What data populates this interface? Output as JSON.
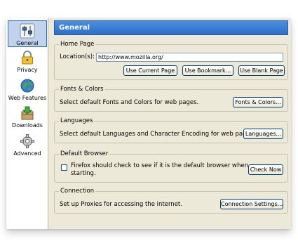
{
  "sidebar": {
    "items": [
      {
        "label": "General",
        "icon": "sliders-icon",
        "selected": true
      },
      {
        "label": "Privacy",
        "icon": "lock-icon"
      },
      {
        "label": "Web Features",
        "icon": "globe-icon"
      },
      {
        "label": "Downloads",
        "icon": "downloads-box-icon"
      },
      {
        "label": "Advanced",
        "icon": "gear-icon"
      }
    ]
  },
  "header": {
    "title": "General"
  },
  "home_page": {
    "title": "Home Page",
    "location_label": "Location(s):",
    "location_value": "http://www.mozilla.org/",
    "use_current": "Use Current Page",
    "use_bookmark": "Use Bookmark...",
    "use_blank": "Use Blank Page"
  },
  "fonts_colors": {
    "title": "Fonts & Colors",
    "description": "Select default Fonts and Colors for web pages.",
    "button": "Fonts & Colors..."
  },
  "languages": {
    "title": "Languages",
    "description": "Select default Languages and Character Encoding for web pages.",
    "button": "Languages..."
  },
  "default_browser": {
    "title": "Default Browser",
    "checkbox_label_line1": "Firefox should check to see if it is the default browser when",
    "checkbox_label_line2": "starting.",
    "checked": false,
    "button": "Check Now"
  },
  "connection": {
    "title": "Connection",
    "description": "Set up Proxies for accessing the internet.",
    "button": "Connection Settings..."
  },
  "colors": {
    "header_blue": "#2f6fc7",
    "panel_bg": "#ece9d8",
    "selected_bg": "#c1d2ee"
  }
}
